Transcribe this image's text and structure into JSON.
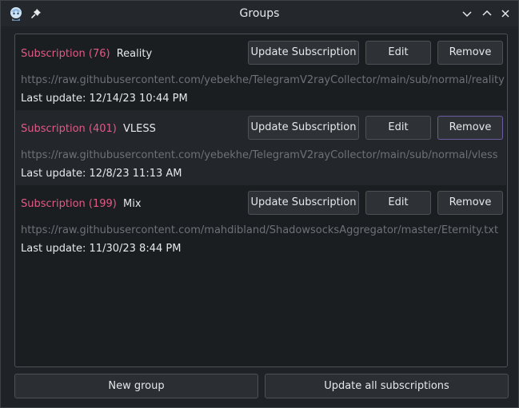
{
  "window": {
    "title": "Groups"
  },
  "groups": [
    {
      "sub_label": "Subscription (76)",
      "name": "Reality",
      "url": "https://raw.githubusercontent.com/yebekhe/TelegramV2rayCollector/main/sub/normal/reality",
      "last_update": "Last update: 12/14/23 10:44 PM"
    },
    {
      "sub_label": "Subscription (401)",
      "name": "VLESS",
      "url": "https://raw.githubusercontent.com/yebekhe/TelegramV2rayCollector/main/sub/normal/vless",
      "last_update": "Last update: 12/8/23 11:13 AM"
    },
    {
      "sub_label": "Subscription (199)",
      "name": "Mix",
      "url": "https://raw.githubusercontent.com/mahdibland/ShadowsocksAggregator/master/Eternity.txt",
      "last_update": "Last update: 11/30/23 8:44 PM"
    }
  ],
  "buttons": {
    "update_subscription": "Update Subscription",
    "edit": "Edit",
    "remove": "Remove",
    "new_group": "New group",
    "update_all": "Update all subscriptions"
  },
  "colors": {
    "accent_subscription": "#e25a86",
    "url_text": "#6d7278",
    "focus_border": "#6b5ea0"
  },
  "icons": {
    "app": "app-logo-icon",
    "pin": "pin-icon",
    "minimize": "chevron-down-icon",
    "maximize": "chevron-up-icon",
    "close": "close-icon"
  }
}
